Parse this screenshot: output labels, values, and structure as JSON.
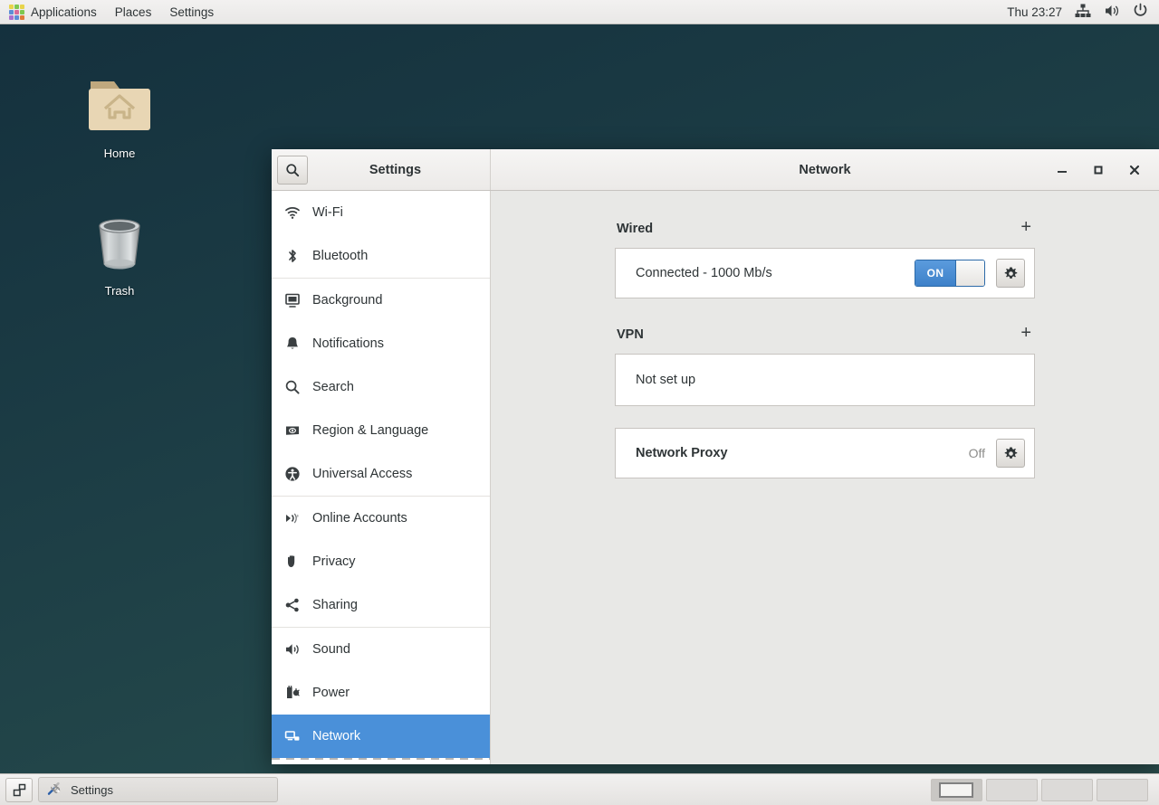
{
  "panel": {
    "menus": [
      {
        "label": "Applications",
        "icon": "apps-grid-icon"
      },
      {
        "label": "Places",
        "icon": null
      },
      {
        "label": "Settings",
        "icon": null
      }
    ],
    "clock": "Thu 23:27",
    "tray": [
      "network-wired-icon",
      "volume-icon",
      "power-icon"
    ]
  },
  "desktop": {
    "icons": [
      {
        "label": "Home",
        "icon": "home-folder-icon"
      },
      {
        "label": "Trash",
        "icon": "trash-icon"
      }
    ],
    "background_color": "#1b3b44"
  },
  "window": {
    "app_title": "Settings",
    "page_title": "Network",
    "search_icon": "search-icon",
    "controls": {
      "minimize": "–",
      "maximize": "□",
      "close": "✕"
    },
    "sidebar": {
      "items": [
        {
          "label": "Wi-Fi",
          "icon": "wifi-icon",
          "selected": false
        },
        {
          "label": "Bluetooth",
          "icon": "bluetooth-icon",
          "selected": false
        },
        {
          "label": "Background",
          "icon": "background-icon",
          "selected": false
        },
        {
          "label": "Notifications",
          "icon": "bell-icon",
          "selected": false
        },
        {
          "label": "Search",
          "icon": "search-icon",
          "selected": false
        },
        {
          "label": "Region & Language",
          "icon": "region-language-icon",
          "selected": false
        },
        {
          "label": "Universal Access",
          "icon": "accessibility-icon",
          "selected": false
        },
        {
          "label": "Online Accounts",
          "icon": "online-accounts-icon",
          "selected": false
        },
        {
          "label": "Privacy",
          "icon": "hand-privacy-icon",
          "selected": false
        },
        {
          "label": "Sharing",
          "icon": "share-icon",
          "selected": false
        },
        {
          "label": "Sound",
          "icon": "sound-icon",
          "selected": false
        },
        {
          "label": "Power",
          "icon": "power-plug-icon",
          "selected": false
        },
        {
          "label": "Network",
          "icon": "network-icon",
          "selected": true
        }
      ],
      "separators_after": [
        1,
        6,
        9
      ],
      "selected_color": "#4a90d9"
    },
    "content": {
      "wired": {
        "title": "Wired",
        "add_label": "+",
        "device_status": "Connected - 1000 Mb/s",
        "toggle_state": "ON",
        "settings_icon": "gear-icon"
      },
      "vpn": {
        "title": "VPN",
        "add_label": "+",
        "status": "Not set up"
      },
      "proxy": {
        "title": "Network Proxy",
        "status": "Off",
        "settings_icon": "gear-icon"
      }
    }
  },
  "taskbar": {
    "show_desktop_icon": "show-desktop-icon",
    "tasks": [
      {
        "label": "Settings",
        "icon": "tools-icon"
      }
    ],
    "workspaces": [
      {
        "active": true
      },
      {
        "active": false
      },
      {
        "active": false
      },
      {
        "active": false
      }
    ]
  }
}
